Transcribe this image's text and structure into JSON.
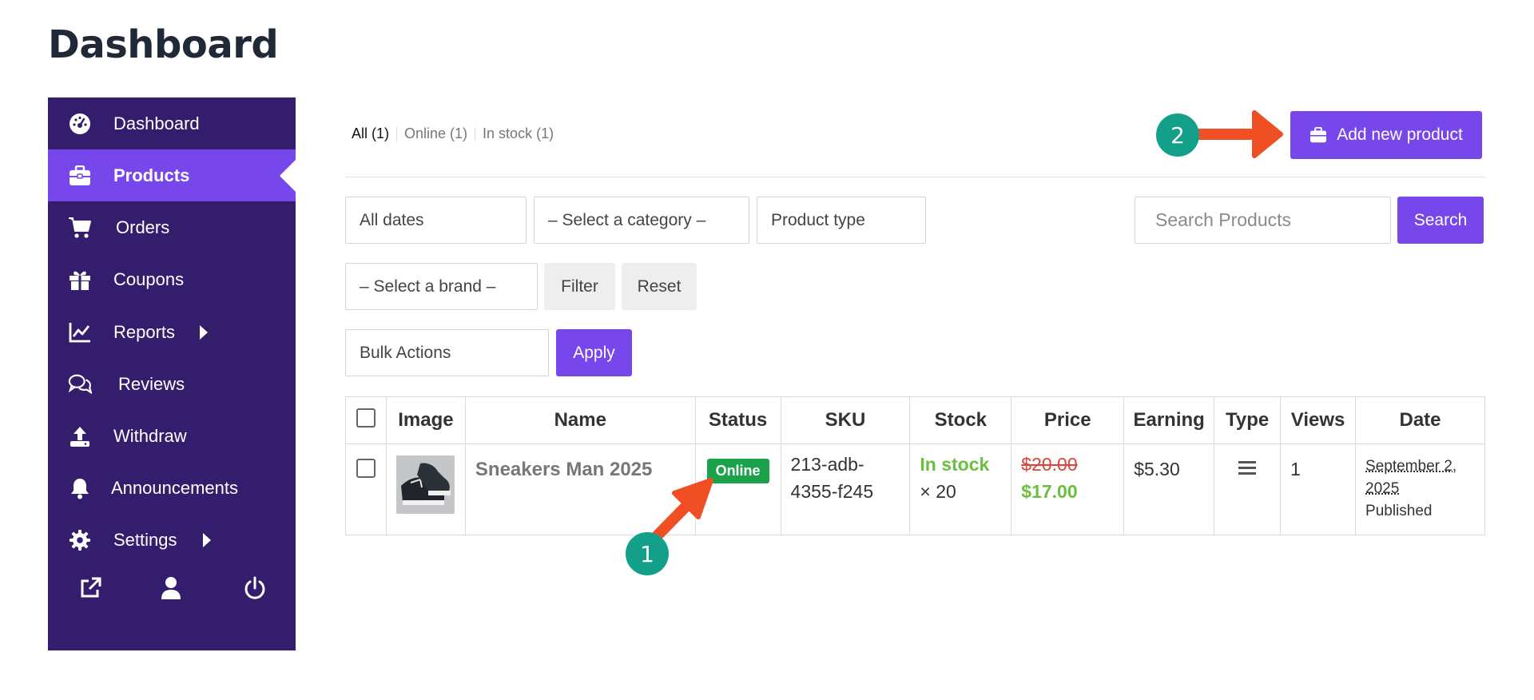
{
  "page": {
    "title": "Dashboard"
  },
  "sidebar": {
    "items": [
      {
        "label": "Dashboard",
        "icon": "dashboard-gauge-icon"
      },
      {
        "label": "Products",
        "icon": "briefcase-icon",
        "active": true
      },
      {
        "label": "Orders",
        "icon": "cart-icon"
      },
      {
        "label": "Coupons",
        "icon": "gift-icon"
      },
      {
        "label": "Reports",
        "icon": "chart-line-icon",
        "has_submenu": true
      },
      {
        "label": "Reviews",
        "icon": "comments-icon"
      },
      {
        "label": "Withdraw",
        "icon": "upload-icon"
      },
      {
        "label": "Announcements",
        "icon": "bell-icon"
      },
      {
        "label": "Settings",
        "icon": "gear-icon",
        "has_submenu": true
      }
    ],
    "bottom_icons": [
      "external-link-icon",
      "user-icon",
      "power-icon"
    ],
    "colors": {
      "background": "#341d6d",
      "active": "#7847eb"
    }
  },
  "status_links": [
    {
      "label": "All (1)",
      "active": true
    },
    {
      "label": "Online (1)"
    },
    {
      "label": "In stock (1)"
    }
  ],
  "toolbar": {
    "add_new_label": "Add new product",
    "search_placeholder": "Search Products",
    "search_label": "Search",
    "date_filter": "All dates",
    "category_filter": "– Select a category –",
    "product_type_filter": "Product type",
    "brand_filter": "– Select a brand –",
    "filter_label": "Filter",
    "reset_label": "Reset",
    "bulk_actions": "Bulk Actions",
    "apply_label": "Apply"
  },
  "table": {
    "headers": [
      "Image",
      "Name",
      "Status",
      "SKU",
      "Stock",
      "Price",
      "Earning",
      "Type",
      "Views",
      "Date"
    ],
    "rows": [
      {
        "name": "Sneakers Man 2025",
        "status": "Online",
        "sku_line1": "213-adb-",
        "sku_line2": "4355-f245",
        "stock_status": "In stock",
        "stock_qty": "× 20",
        "regular_price": "$20.00",
        "sale_price": "$17.00",
        "earning": "$5.30",
        "type_icon": "list-icon",
        "views": "1",
        "date_line1": "September 2,",
        "date_line2": "2025",
        "date_status": "Published"
      }
    ]
  },
  "annotations": [
    {
      "label": "1"
    },
    {
      "label": "2"
    }
  ],
  "colors": {
    "accent": "#7847eb",
    "success": "#1aa34a",
    "in_stock": "#6abf40",
    "sale_strike": "#d9443c",
    "annotation_arrow": "#f04e23",
    "annotation_badge": "#12a08a"
  }
}
